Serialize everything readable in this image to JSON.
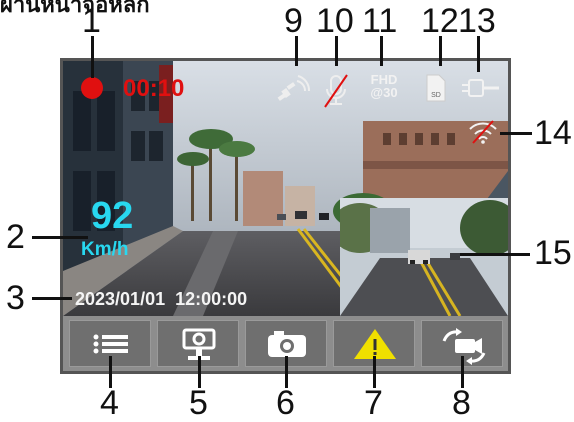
{
  "hud": {
    "rec_time": "00:10",
    "speed_value": "92",
    "speed_unit": "Km/h",
    "datetime": "2023/01/01  12:00:00",
    "resolution_top": "FHD",
    "resolution_bottom": "@30",
    "sd_label": "SD"
  },
  "header_fragment": "ผ่านหน้าจอหลัก",
  "callouts": {
    "c1": "1",
    "c2": "2",
    "c3": "3",
    "c4": "4",
    "c5": "5",
    "c6": "6",
    "c7": "7",
    "c8": "8",
    "c9": "9",
    "c10": "10",
    "c11": "11",
    "c12": "12",
    "c13": "13",
    "c14": "14",
    "c15": "15"
  },
  "toolbar_icons": [
    "menu-icon",
    "parking-mode-icon",
    "camera-icon",
    "warning-icon",
    "switch-camera-icon"
  ],
  "colors": {
    "rec_red": "#e01010",
    "speed_cyan": "#28d8f0",
    "warning_yellow": "#f0e000",
    "toolbar_bg": "#8d8d8d",
    "button_bg": "#6f6f6f"
  }
}
